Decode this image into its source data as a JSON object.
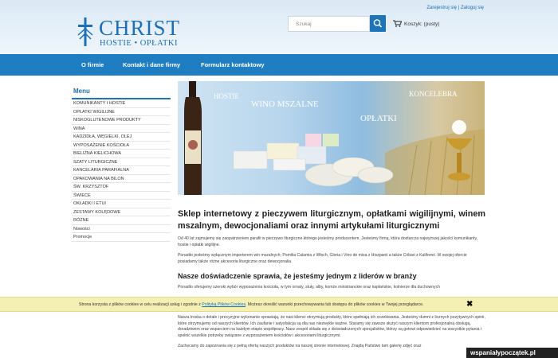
{
  "header": {
    "logo": {
      "title": "CHRIST",
      "subtitle": "HOSTIE • OPŁATKI"
    },
    "top_links": {
      "register": "Zarejestruj się",
      "separator": "|",
      "login": "Zaloguj się"
    },
    "search": {
      "placeholder": "Szukaj"
    },
    "cart": {
      "label": "Koszyk: (pusty)"
    }
  },
  "nav": {
    "items": [
      "O firmie",
      "Kontakt i dane firmy",
      "Formularz kontaktowy"
    ]
  },
  "sidebar": {
    "title": "Menu",
    "items": [
      "KOMUNIKANTY I HOSTIE",
      "OPŁATKI WIGILIJNE",
      "NISKOGLUTENOWE PRODUKTY",
      "WINA",
      "KADZIDŁA, WĘGIELKI, OLEJ",
      "WYPOSAŻENIE KOŚCIOŁA",
      "BIELIŹNA KIELICHOWA",
      "SZATY LITURGICZNE",
      "KANCELARIA PARAFIALNA",
      "OPAKOWANIA NA BILON",
      "ŚW. KRZYSZTOF",
      "ŚWIECE",
      "OKŁADKI I ETUI",
      "ZESTAWY KOLĘDOWE",
      "RÓŻNE",
      "Nowości",
      "Promocje"
    ]
  },
  "banner": {
    "labels": [
      "HOSTIE",
      "WINO MSZALNE",
      "KONCELEBRA",
      "OPŁATKI"
    ]
  },
  "content": {
    "heading": "Sklep internetowy z pieczywem liturgicznym, opłatkami wigilijnymi, winem mszalnym, dewocjonaliami oraz innymi artykułami liturgicznymi",
    "p1": "Od 40 lat zajmujemy się zaopatrzeniem parafii w pieczywo liturgiczne którego jesteśmy producentem. Jesteśmy firmą, która dostarcza najwyższej jakości komunikanty, hostie i opłatki wigilijne.",
    "p2": "Ponadto jesteśmy wyłącznym importerem win mszalnych; Pomilia Calamia z Włoch, Gloria i Vino de misa z Hiszpanii a także Cribari z Kalifornii. W swojej ofercie posiadamy także różne akcesoria liturgiczne oraz dewocjonalia.",
    "h2": "Nasze doświadczenie sprawia, że jesteśmy jednym z liderów w branży",
    "p3": "Ponadto oferujemy szeroki wybór wyposażenia kościoła, w tym ornaty, stuły, alby, komże ministranckie oraz kapłańskie, kolnierze dla duchownych",
    "p4": "Nasza troska o detale i precyzyjne wykonanie sprawiają, że nasi klienci otrzymują produkty, które spełniają ich oczekiwania. Jesteśmy dumni z licznych pozytywnych opinii, które otrzymujemy od naszych klientów. Ich zaufanie i satysfakcja są dla nas niezwykle ważne. Staramy się zawsze służyć naszym klientom profesjonalną obsługą, doradztwem oraz wsparciem na każdym etapie współpracy. Nasz zespół składa się z doświadczonych specjalistów, którzy są gotowi odpowiedzieć na wszystkie pytania i spełnić wszelkie potrzeby związane z wyposażeniem kościołów i akcesoriami liturgicznymi.",
    "p5": "Zachęcamy do zapoznania się z pełną ofertą naszych produktów na naszej stronie internetowej. Znajdą Państwo tam galerię zdjęć oraz"
  },
  "cookie": {
    "text_before": "Strona korzysta z plików cookies w celu realizacji usług i zgodnie z ",
    "link": "Polityką Plików Cookies",
    "text_after": ". Możesz określić warunki przechowywania lub dostępu do plików cookies w Twojej przeglądarce.",
    "close": "✖"
  },
  "watermark": "wspaniałypoczątek.pl",
  "colors": {
    "brand": "#1e6fb5",
    "nav_bg": "#1f7dc2",
    "cookie_bg": "#f4efb3"
  }
}
